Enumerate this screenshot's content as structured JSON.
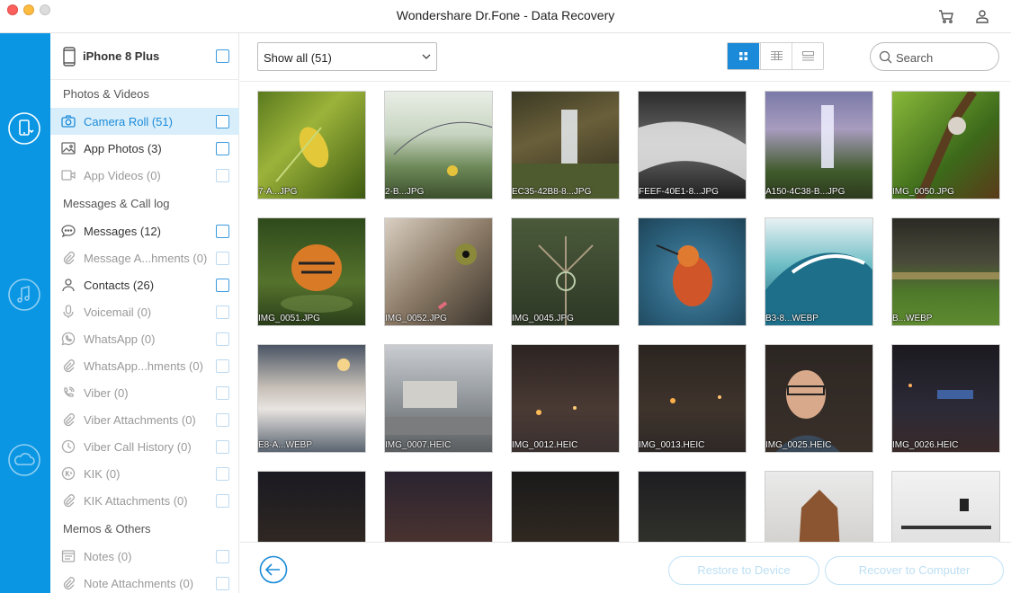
{
  "window": {
    "title": "Wondershare Dr.Fone - Data Recovery"
  },
  "titlebar_icons": [
    "cart-icon",
    "user-icon"
  ],
  "rail": {
    "items": [
      "phone-recover-icon",
      "music-recover-icon",
      "cloud-recover-icon"
    ]
  },
  "device": {
    "name": "iPhone 8 Plus"
  },
  "sidebar": {
    "section_photos": "Photos & Videos",
    "camera_roll": "Camera Roll (51)",
    "app_photos": "App Photos (3)",
    "app_videos": "App Videos (0)",
    "section_messages": "Messages & Call log",
    "messages": "Messages (12)",
    "message_attachments": "Message A...hments (0)",
    "contacts": "Contacts (26)",
    "voicemail": "Voicemail (0)",
    "whatsapp": "WhatsApp (0)",
    "whatsapp_attachments": "WhatsApp...hments (0)",
    "viber": "Viber (0)",
    "viber_attachments": "Viber Attachments (0)",
    "viber_call_history": "Viber Call History (0)",
    "kik": "KIK (0)",
    "kik_attachments": "KIK Attachments (0)",
    "section_memos": "Memos & Others",
    "notes": "Notes (0)",
    "note_attachments": "Note Attachments (0)"
  },
  "toolbar": {
    "filter_value": "Show all (51)",
    "search_placeholder": "Search"
  },
  "thumbs": {
    "t0": "7-A...JPG",
    "t1": "2-B...JPG",
    "t2": "EC35-42B8-8...JPG",
    "t3": "FEEF-40E1-8...JPG",
    "t4": "A150-4C38-B...JPG",
    "t5": "IMG_0050.JPG",
    "t6": "IMG_0051.JPG",
    "t7": "IMG_0052.JPG",
    "t8": "IMG_0045.JPG",
    "t9": "",
    "t10": "B3-8...WEBP",
    "t11": "B...WEBP",
    "t12": "E8-A...WEBP",
    "t13": "IMG_0007.HEIC",
    "t14": "IMG_0012.HEIC",
    "t15": "IMG_0013.HEIC",
    "t16": "IMG_0025.HEIC",
    "t17": "IMG_0026.HEIC"
  },
  "footer": {
    "restore_label": "Restore to Device",
    "recover_label": "Recover to Computer"
  },
  "colors": {
    "accent": "#0a96e3",
    "active_bg": "#d9eefb",
    "checkbox": "#3b9be0"
  }
}
